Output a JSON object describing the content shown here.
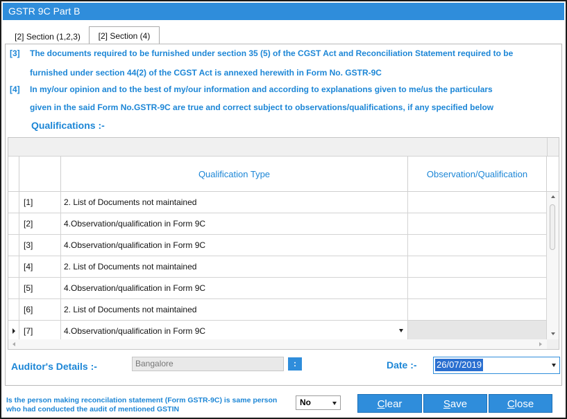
{
  "window": {
    "title": "GSTR 9C Part B"
  },
  "tabs": [
    {
      "label": "[2] Section (1,2,3)"
    },
    {
      "label": "[2] Section (4)"
    }
  ],
  "statements": [
    {
      "num": "[3]",
      "line1": "The documents required to be furnished under section 35 (5) of the CGST Act and Reconciliation Statement required to be",
      "line2": "furnished under section 44(2) of the CGST Act is annexed herewith in Form No. GSTR-9C"
    },
    {
      "num": "[4]",
      "line1": "In my/our opinion and to the best of my/our information and according to explanations given to me/us the particulars",
      "line2": "given in the said Form No.GSTR-9C are true and correct subject to  observations/qualifications, if any specified below"
    }
  ],
  "qualifications": {
    "title": "Qualifications :-",
    "columns": {
      "type": "Qualification Type",
      "obs": "Observation/Qualification"
    },
    "rows": [
      {
        "num": "[1]",
        "type": "2. List of Documents not maintained",
        "obs": ""
      },
      {
        "num": "[2]",
        "type": "4.Observation/qualification in Form 9C",
        "obs": ""
      },
      {
        "num": "[3]",
        "type": "4.Observation/qualification in Form 9C",
        "obs": ""
      },
      {
        "num": "[4]",
        "type": "2. List of Documents not maintained",
        "obs": ""
      },
      {
        "num": "[5]",
        "type": "4.Observation/qualification in Form 9C",
        "obs": ""
      },
      {
        "num": "[6]",
        "type": "2. List of Documents not maintained",
        "obs": ""
      },
      {
        "num": "[7]",
        "type": "4.Observation/qualification in Form 9C",
        "obs": ""
      }
    ]
  },
  "auditor": {
    "label": "Auditor's Details :-",
    "value": "Bangalore",
    "lookup": ":"
  },
  "date": {
    "label": "Date :-",
    "value": "26/07/2019"
  },
  "question": {
    "line1": "Is the person making reconcilation statement (Form GSTR-9C) is same person",
    "line2": "who had conducted the audit of mentioned GSTIN",
    "answer": "No"
  },
  "buttons": {
    "clear": {
      "first": "C",
      "rest": "lear"
    },
    "save": {
      "first": "S",
      "rest": "ave"
    },
    "close": {
      "first": "C",
      "rest": "lose"
    }
  },
  "colors": {
    "accent": "#2f8ddb",
    "label": "#1c86d6",
    "selection": "#2a6fd0"
  }
}
